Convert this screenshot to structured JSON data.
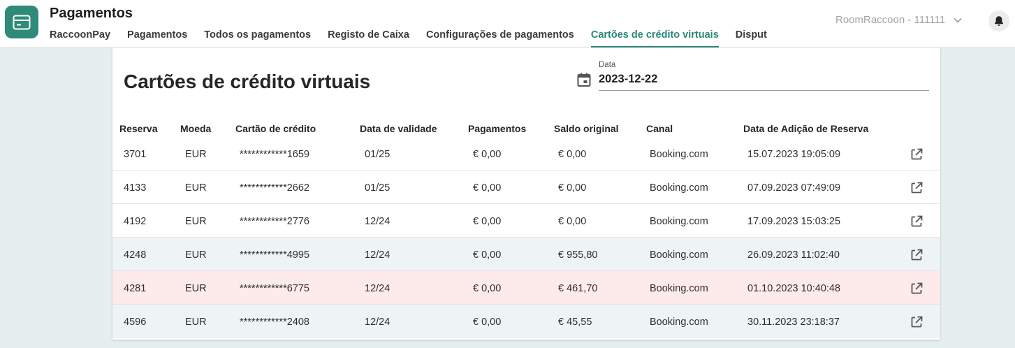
{
  "app": {
    "title": "Pagamentos",
    "icon": "credit-card-icon",
    "accent_color": "#2b8778"
  },
  "tabs": [
    {
      "label": "RaccoonPay",
      "active": false
    },
    {
      "label": "Pagamentos",
      "active": false
    },
    {
      "label": "Todos os pagamentos",
      "active": false
    },
    {
      "label": "Registo de Caixa",
      "active": false
    },
    {
      "label": "Configurações de pagamentos",
      "active": false
    },
    {
      "label": "Cartões de crédito virtuais",
      "active": true
    },
    {
      "label": "Disput",
      "active": false
    }
  ],
  "account": {
    "label": "RoomRaccoon - 111111",
    "chevron_icon": "chevron-down-icon",
    "bell_icon": "bell-icon"
  },
  "page": {
    "title": "Cartões de crédito virtuais",
    "date_label": "Data",
    "date_value": "2023-12-22",
    "calendar_icon": "calendar-icon"
  },
  "table": {
    "headers": [
      "Reserva",
      "Moeda",
      "Cartão de crédito",
      "Data de validade",
      "Pagamentos",
      "Saldo original",
      "Canal",
      "Data de Adição de Reserva"
    ],
    "row_icon": "external-link-icon",
    "rows": [
      {
        "reserva": "3701",
        "moeda": "EUR",
        "cartao": "************1659",
        "validade": "01/25",
        "pagamentos": "€ 0,00",
        "saldo": "€ 0,00",
        "canal": "Booking.com",
        "data_adicao": "15.07.2023 19:05:09",
        "tint": "none"
      },
      {
        "reserva": "4133",
        "moeda": "EUR",
        "cartao": "************2662",
        "validade": "01/25",
        "pagamentos": "€ 0,00",
        "saldo": "€ 0,00",
        "canal": "Booking.com",
        "data_adicao": "07.09.2023 07:49:09",
        "tint": "none"
      },
      {
        "reserva": "4192",
        "moeda": "EUR",
        "cartao": "************2776",
        "validade": "12/24",
        "pagamentos": "€ 0,00",
        "saldo": "€ 0,00",
        "canal": "Booking.com",
        "data_adicao": "17.09.2023 15:03:25",
        "tint": "none"
      },
      {
        "reserva": "4248",
        "moeda": "EUR",
        "cartao": "************4995",
        "validade": "12/24",
        "pagamentos": "€ 0,00",
        "saldo": "€ 955,80",
        "canal": "Booking.com",
        "data_adicao": "26.09.2023 11:02:40",
        "tint": "blue"
      },
      {
        "reserva": "4281",
        "moeda": "EUR",
        "cartao": "************6775",
        "validade": "12/24",
        "pagamentos": "€ 0,00",
        "saldo": "€ 461,70",
        "canal": "Booking.com",
        "data_adicao": "01.10.2023 10:40:48",
        "tint": "red"
      },
      {
        "reserva": "4596",
        "moeda": "EUR",
        "cartao": "************2408",
        "validade": "12/24",
        "pagamentos": "€ 0,00",
        "saldo": "€ 45,55",
        "canal": "Booking.com",
        "data_adicao": "30.11.2023 23:18:37",
        "tint": "blue"
      }
    ]
  }
}
